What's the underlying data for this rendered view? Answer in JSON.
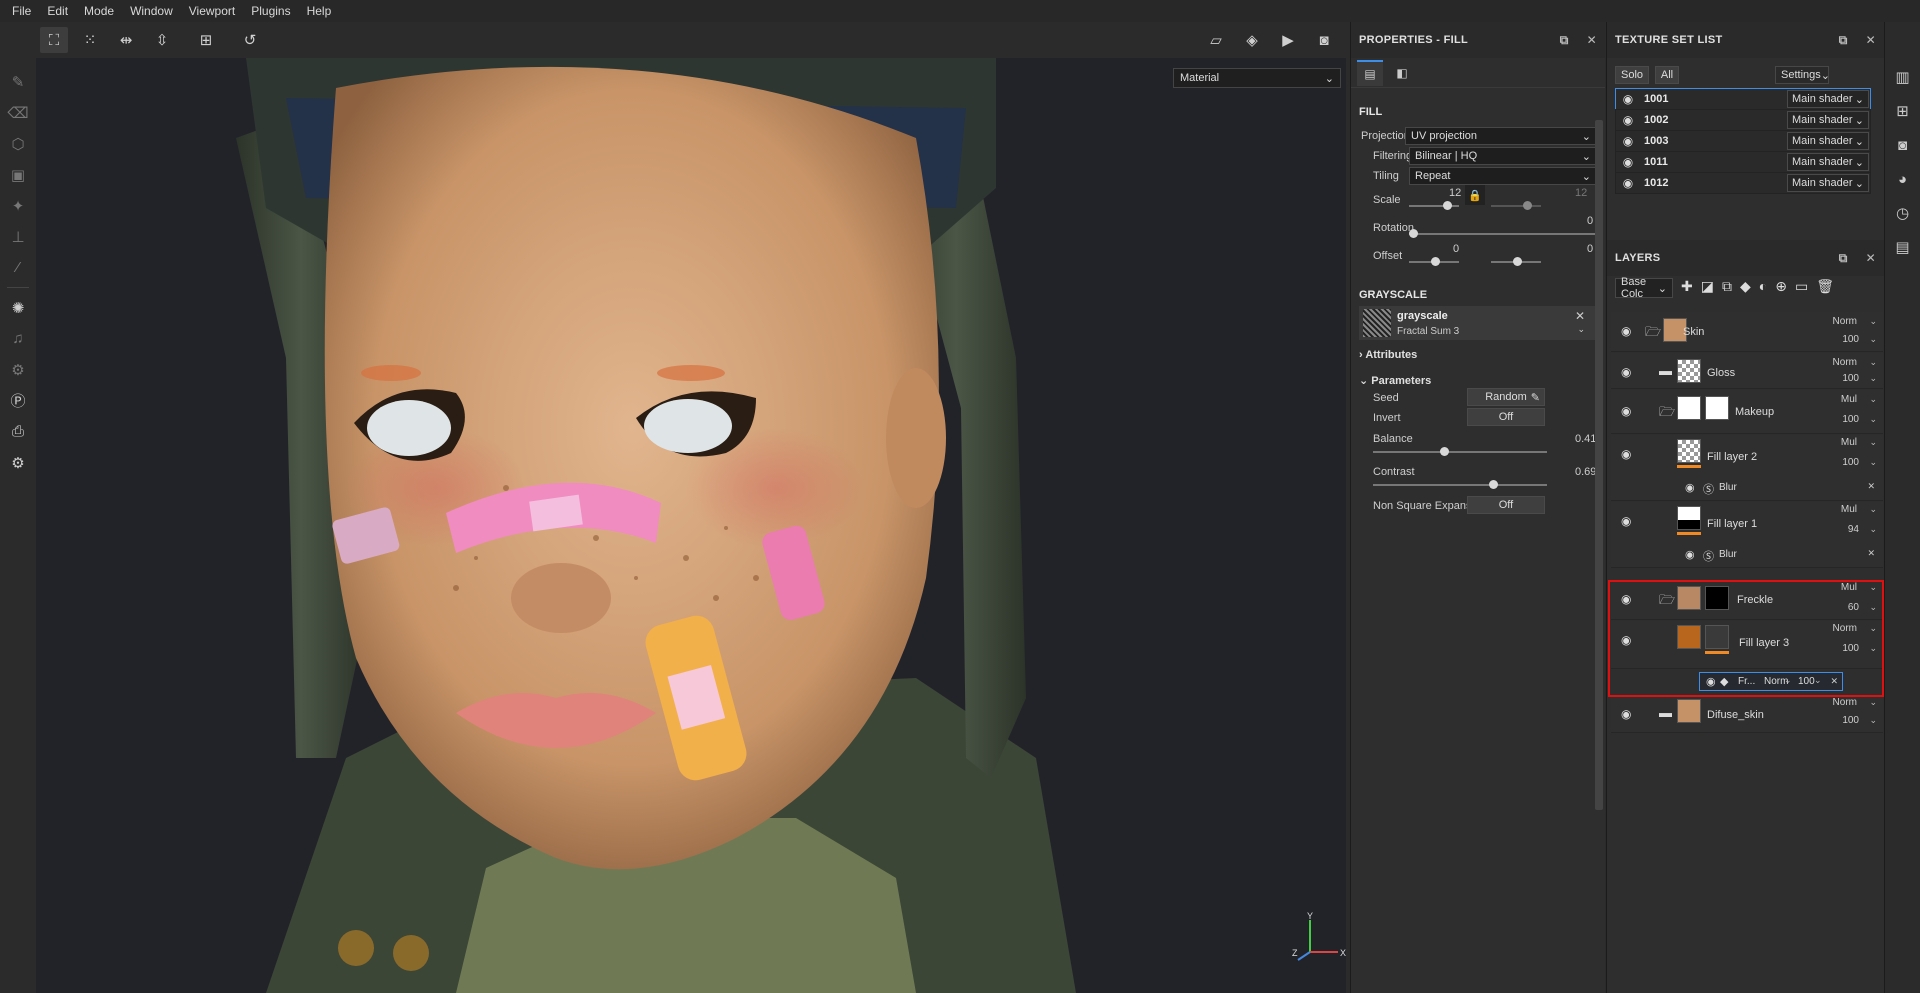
{
  "menu": [
    "File",
    "Edit",
    "Mode",
    "Window",
    "Viewport",
    "Plugins",
    "Help"
  ],
  "viewport": {
    "material_select": "Material"
  },
  "properties": {
    "title": "PROPERTIES - FILL",
    "fill_label": "FILL",
    "projection": {
      "label": "Projection",
      "value": "UV projection"
    },
    "filtering": {
      "label": "Filtering",
      "value": "Bilinear | HQ"
    },
    "tiling": {
      "label": "Tiling",
      "value": "Repeat"
    },
    "scale": {
      "label": "Scale",
      "value1": "12",
      "value2": "12"
    },
    "rotation": {
      "label": "Rotation",
      "value": "0"
    },
    "offset": {
      "label": "Offset",
      "value1": "0",
      "value2": "0"
    },
    "grayscale_label": "GRAYSCALE",
    "grayscale_resource": {
      "name": "grayscale",
      "sub": "Fractal Sum 3"
    },
    "attributes_label": "Attributes",
    "parameters_label": "Parameters",
    "seed": {
      "label": "Seed",
      "value": "Random"
    },
    "invert": {
      "label": "Invert",
      "value": "Off"
    },
    "balance": {
      "label": "Balance",
      "value": "0.41",
      "fraction": 0.41
    },
    "contrast": {
      "label": "Contrast",
      "value": "0.69",
      "fraction": 0.69
    },
    "non_square": {
      "label": "Non Square Expansion",
      "value": "Off"
    }
  },
  "texture_set_list": {
    "title": "TEXTURE SET LIST",
    "solo": "Solo",
    "all": "All",
    "settings": "Settings",
    "sets": [
      {
        "name": "1001",
        "shader": "Main shader"
      },
      {
        "name": "1002",
        "shader": "Main shader"
      },
      {
        "name": "1003",
        "shader": "Main shader"
      },
      {
        "name": "1011",
        "shader": "Main shader"
      },
      {
        "name": "1012",
        "shader": "Main shader"
      }
    ]
  },
  "layers": {
    "title": "LAYERS",
    "channel": "Base Colc",
    "items": [
      {
        "name": "Skin",
        "blend": "Norm",
        "opacity": "100"
      },
      {
        "name": "Gloss",
        "blend": "Norm",
        "opacity": "100"
      },
      {
        "name": "Makeup",
        "blend": "Mul",
        "opacity": "100"
      },
      {
        "name": "Fill layer 2",
        "blend": "Mul",
        "opacity": "100",
        "effect": "Blur"
      },
      {
        "name": "Fill layer 1",
        "blend": "Mul",
        "opacity": "94",
        "effect": "Blur"
      },
      {
        "name": "Freckle",
        "blend": "Mul",
        "opacity": "60"
      },
      {
        "name": "Fill layer 3",
        "blend": "Norm",
        "opacity": "100"
      },
      {
        "name": "Difuse_skin",
        "blend": "Norm",
        "opacity": "100"
      }
    ],
    "sub_fill": {
      "name": "Fr...",
      "blend": "Norm",
      "opacity": "100"
    }
  },
  "colors": {
    "accent": "#3d8ee8",
    "highlight": "#e01010",
    "mask_bar": "#f08a24"
  }
}
